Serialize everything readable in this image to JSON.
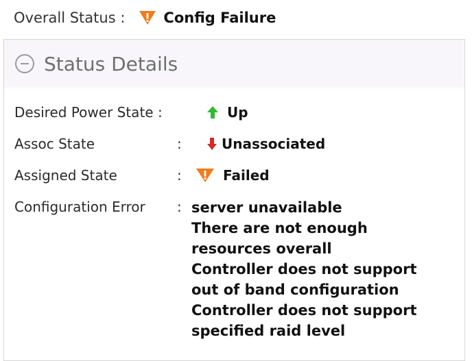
{
  "overall": {
    "label": "Overall Status :",
    "value": "Config Failure",
    "icon": "warning-triangle-icon"
  },
  "details": {
    "title": "Status Details",
    "rows": [
      {
        "label": "Desired Power State :",
        "value": "Up",
        "icon": "arrow-up-icon"
      },
      {
        "label": "Assoc State",
        "colon": ":",
        "value": "Unassociated",
        "icon": "arrow-down-icon"
      },
      {
        "label": "Assigned State",
        "colon": ":",
        "value": "Failed",
        "icon": "warning-triangle-icon"
      },
      {
        "label": "Configuration Error",
        "colon": ":",
        "lines": [
          "server unavailable",
          "There are not enough",
          "resources overall",
          "Controller does not support",
          "out of band configuration",
          "Controller does not support",
          "specified raid level"
        ]
      }
    ]
  },
  "colors": {
    "warning": "#f07c1c",
    "up": "#2dbb2d",
    "down": "#d42a2a"
  }
}
